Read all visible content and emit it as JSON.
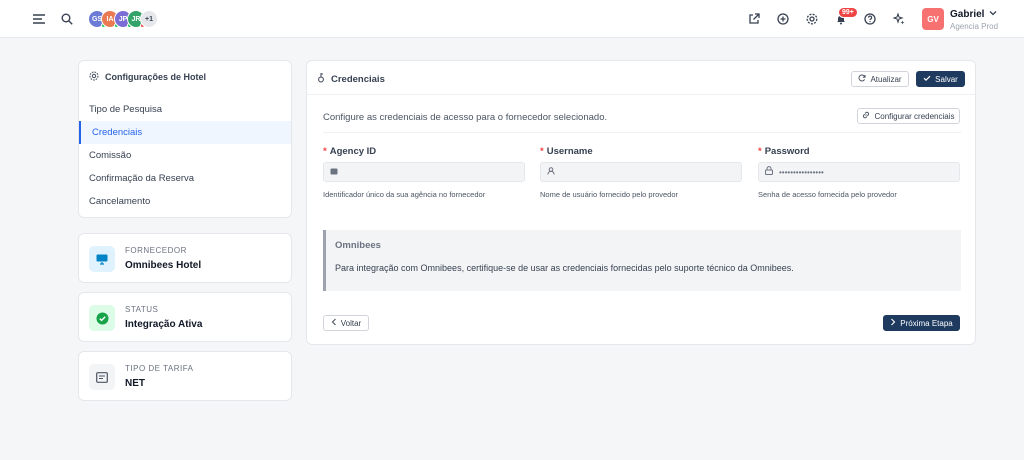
{
  "topbar": {
    "avatars": [
      {
        "initials": "GS",
        "color": "#6b7bd6",
        "status": "#22c55e"
      },
      {
        "initials": "IA",
        "color": "#ea7a52",
        "status": "#22c55e"
      },
      {
        "initials": "JP",
        "color": "#7c6cd6",
        "status": "#22c55e"
      },
      {
        "initials": "JR",
        "color": "#34a36a",
        "status": "#ef4444"
      }
    ],
    "avatars_more": "+1",
    "notifications_badge": "99+",
    "user": {
      "initials": "GV",
      "name": "Gabriel",
      "agency": "Agencia Prod"
    }
  },
  "sidebar": {
    "title": "Configurações de Hotel",
    "items": [
      {
        "label": "Tipo de Pesquisa",
        "active": false
      },
      {
        "label": "Credenciais",
        "active": true
      },
      {
        "label": "Comissão",
        "active": false
      },
      {
        "label": "Confirmação da Reserva",
        "active": false
      },
      {
        "label": "Cancelamento",
        "active": false
      }
    ]
  },
  "info_cards": [
    {
      "label": "FORNECEDOR",
      "value": "Omnibees Hotel",
      "icon": "monitor-icon",
      "icon_bg": "#e0f2fe",
      "icon_color": "#0284c7"
    },
    {
      "label": "STATUS",
      "value": "Integração Ativa",
      "icon": "check-circle-icon",
      "icon_bg": "#dcfce7",
      "icon_color": "#16a34a"
    },
    {
      "label": "TIPO DE TARIFA",
      "value": "NET",
      "icon": "receipt-icon",
      "icon_bg": "#f3f4f6",
      "icon_color": "#4b5563"
    }
  ],
  "main": {
    "title": "Credenciais",
    "refresh_label": "Atualizar",
    "save_label": "Salvar",
    "description": "Configure as credenciais de acesso para o fornecedor selecionado.",
    "configure_label": "Configurar credenciais",
    "fields": [
      {
        "label": "Agency ID",
        "value": "",
        "help": "Identificador único da sua agência no fornecedor"
      },
      {
        "label": "Username",
        "value": "",
        "help": "Nome de usuário fornecido pelo provedor"
      },
      {
        "label": "Password",
        "value": "••••••••••••••••",
        "help": "Senha de acesso fornecida pelo provedor"
      }
    ],
    "note_title": "Omnibees",
    "note_text": "Para integração com Omnibees, certifique-se de usar as credenciais fornecidas pelo suporte técnico da Omnibees.",
    "back_label": "Voltar",
    "next_label": "Próxima Etapa"
  },
  "colors": {
    "accent": "#2563eb",
    "primary_button": "#1e3a5f",
    "danger": "#ef4444"
  }
}
